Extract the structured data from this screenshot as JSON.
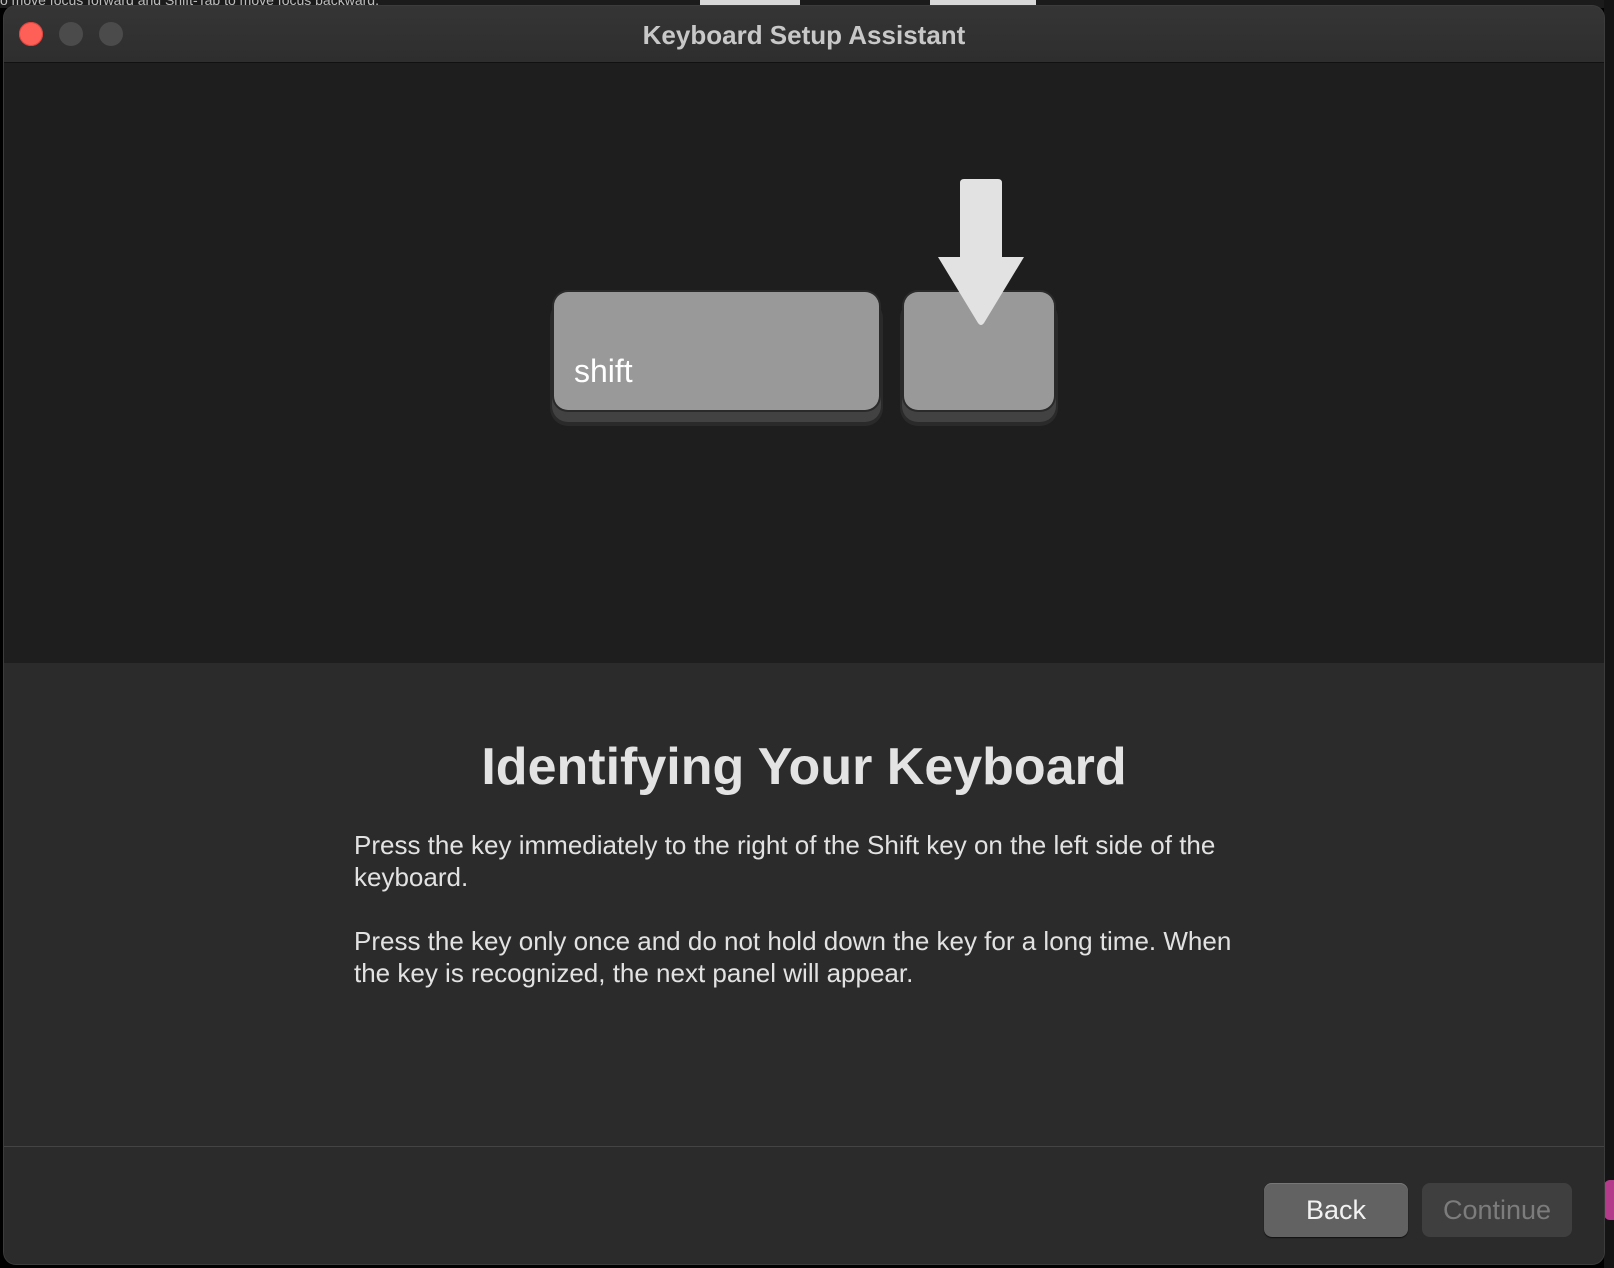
{
  "backdrop": {
    "hint_text": "o move focus forward and Shift-Tab to move focus backward."
  },
  "window": {
    "title": "Keyboard Setup Assistant"
  },
  "illustration": {
    "shift_key_label": "shift",
    "arrow_icon": "down-arrow-icon"
  },
  "content": {
    "heading": "Identifying Your Keyboard",
    "paragraph_1": "Press the key immediately to the right of the Shift key on the left side of the keyboard.",
    "paragraph_2": "Press the key only once and do not hold down the key for a long time. When the key is recognized, the next panel will appear."
  },
  "footer": {
    "back_label": "Back",
    "continue_label": "Continue",
    "continue_enabled": false
  },
  "colors": {
    "close_button": "#fe5f57",
    "key_fill": "#999999",
    "arrow_fill": "#e2e2e2"
  }
}
